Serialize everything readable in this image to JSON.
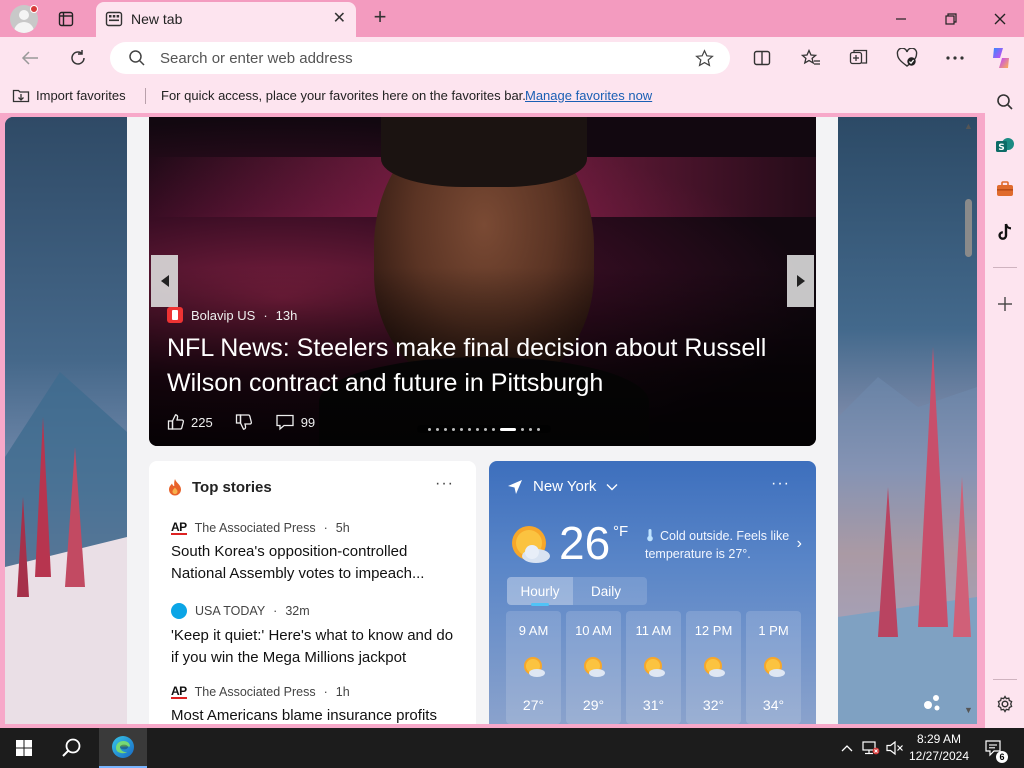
{
  "browser": {
    "tab_title": "New tab",
    "address_placeholder": "Search or enter web address"
  },
  "favorites_bar": {
    "import_label": "Import favorites",
    "hint": "For quick access, place your favorites here on the favorites bar.",
    "manage_link": "Manage favorites now"
  },
  "hero": {
    "source": "Bolavip US",
    "age": "13h",
    "title": "NFL News: Steelers make final decision about Russell Wilson contract and future in Pittsburgh",
    "likes": "225",
    "comments": "99",
    "slide_count": 13,
    "active_slide": 9
  },
  "top_stories": {
    "title": "Top stories",
    "items": [
      {
        "source": "The Associated Press",
        "age": "5h",
        "logo": "AP",
        "headline": "South Korea's opposition-controlled National Assembly votes to impeach..."
      },
      {
        "source": "USA TODAY",
        "age": "32m",
        "logo": "usa-today",
        "headline": "'Keep it quiet:' Here's what to know and do if you win the Mega Millions jackpot"
      },
      {
        "source": "The Associated Press",
        "age": "1h",
        "logo": "AP",
        "headline": "Most Americans blame insurance profits"
      }
    ]
  },
  "weather": {
    "location": "New York",
    "temperature": "26",
    "unit": "°F",
    "description": "Cold outside. Feels like temperature is 27°.",
    "tabs": [
      "Hourly",
      "Daily"
    ],
    "active_tab": "Hourly",
    "hourly": [
      {
        "time": "9 AM",
        "temp": "27°",
        "icon": "partly-sunny-icon"
      },
      {
        "time": "10 AM",
        "temp": "29°",
        "icon": "partly-sunny-icon"
      },
      {
        "time": "11 AM",
        "temp": "31°",
        "icon": "partly-sunny-icon"
      },
      {
        "time": "12 PM",
        "temp": "32°",
        "icon": "partly-sunny-icon"
      },
      {
        "time": "1 PM",
        "temp": "34°",
        "icon": "partly-sunny-icon"
      }
    ]
  },
  "taskbar": {
    "time": "8:29 AM",
    "date": "12/27/2024",
    "notification_count": "6"
  },
  "colors": {
    "browser_chrome": "#fde4ef",
    "tab_strip": "#f39bbf",
    "link": "#1a5fb4",
    "weather_card": "#3d6fbd"
  }
}
